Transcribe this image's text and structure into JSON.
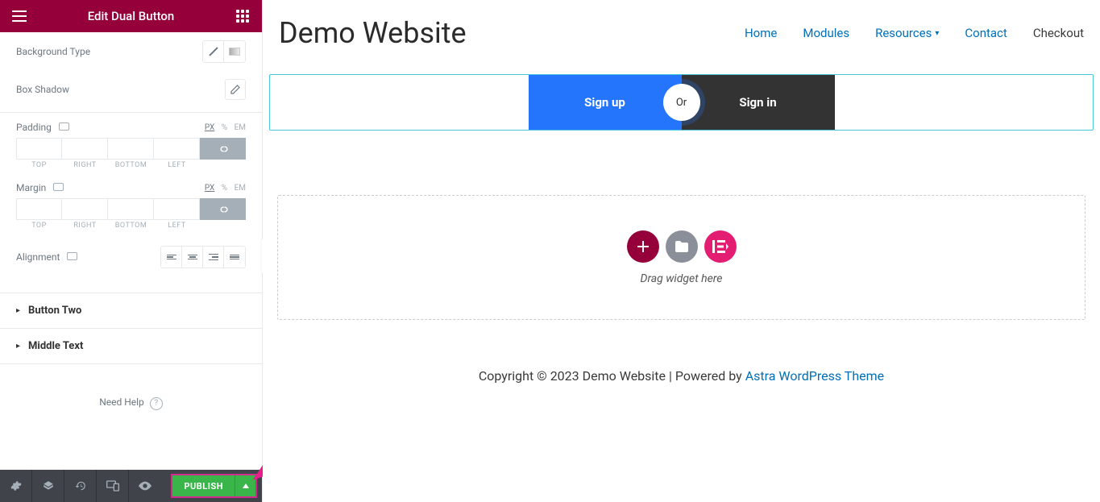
{
  "panel": {
    "title": "Edit Dual Button",
    "background_type_label": "Background Type",
    "box_shadow_label": "Box Shadow",
    "padding_label": "Padding",
    "margin_label": "Margin",
    "alignment_label": "Alignment",
    "units": {
      "px": "PX",
      "pct": "%",
      "em": "EM"
    },
    "dim_labels": {
      "top": "TOP",
      "right": "RIGHT",
      "bottom": "BOTTOM",
      "left": "LEFT"
    },
    "accordion": {
      "button_two": "Button Two",
      "middle_text": "Middle Text"
    },
    "need_help": "Need Help"
  },
  "footer": {
    "publish": "PUBLISH"
  },
  "preview": {
    "site_title": "Demo Website",
    "nav": {
      "home": "Home",
      "modules": "Modules",
      "resources": "Resources",
      "contact": "Contact",
      "checkout": "Checkout"
    },
    "dual": {
      "one": "Sign up",
      "middle": "Or",
      "two": "Sign in"
    },
    "dropzone": "Drag widget here",
    "footer_text": "Copyright © 2023 Demo Website | Powered by ",
    "footer_link": "Astra WordPress Theme"
  }
}
